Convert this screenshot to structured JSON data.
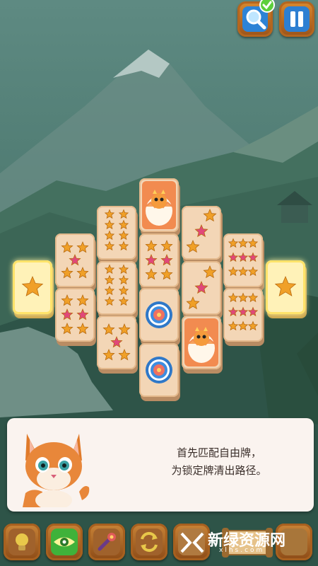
{
  "hint": {
    "message_line1": "首先匹配自由牌，",
    "message_line2": "为锁定牌清出路径。"
  },
  "watermark": {
    "title": "新绿资源网",
    "subtitle": "xlhs.com"
  },
  "top_buttons": [
    "magnifier-hint-icon",
    "pause-icon"
  ],
  "bottom_buttons": [
    "lightbulb-icon",
    "eye-icon",
    "magic-wand-icon",
    "shuffle-icon",
    "undo-icon",
    "scroll-icon"
  ],
  "tiles": {
    "free_tiles": [
      "star-1",
      "star-1"
    ],
    "board": [
      "dragon-egg",
      "star-2",
      "star-3",
      "star-6",
      "star-7",
      "star-9",
      "flower-badge"
    ]
  },
  "colors": {
    "background": "#3f6a62",
    "tile_face": "#f3d6b6",
    "free_tile_glow": "#ffe36a",
    "star_orange": "#f0a028",
    "star_pink": "#e0487a",
    "button_wood": "#b4661f",
    "dialog_bg": "#faf3ef"
  }
}
